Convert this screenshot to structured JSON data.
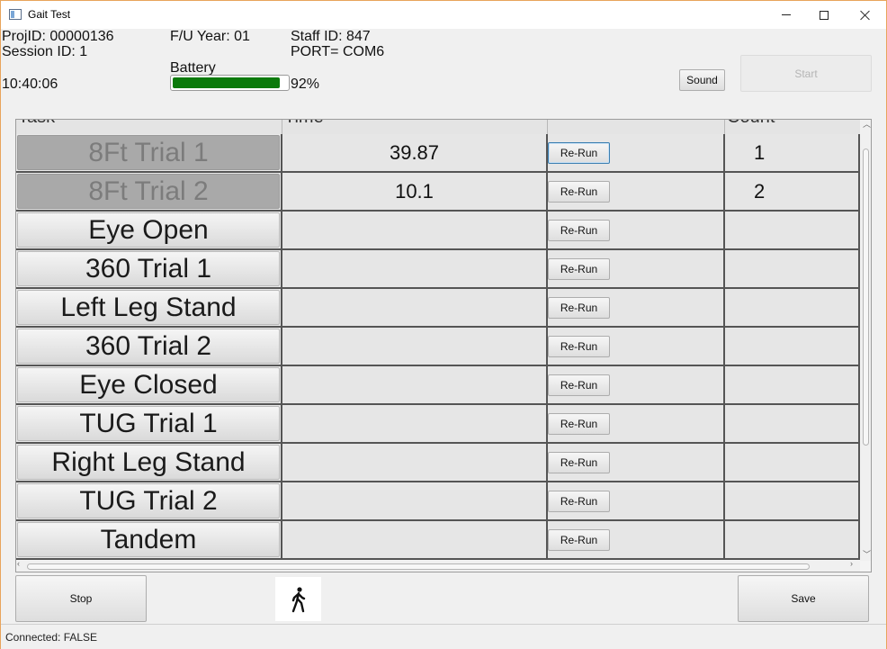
{
  "window": {
    "title": "Gait Test"
  },
  "header": {
    "proj_id": "ProjID: 00000136",
    "session_id": "Session ID: 1",
    "fu_year": "F/U Year: 01",
    "staff_id": "Staff ID: 847",
    "port": "PORT= COM6",
    "battery_label": "Battery",
    "battery_percent": 92,
    "battery_text": "92%",
    "time": "10:40:06",
    "sound_label": "Sound",
    "start_label": "Start"
  },
  "table": {
    "columns": [
      "Task",
      "Time",
      "",
      "Count"
    ],
    "rows": [
      {
        "task": "8Ft Trial 1",
        "time": "39.87",
        "rerun": "Re-Run",
        "count": "1",
        "done": true,
        "focused": true
      },
      {
        "task": "8Ft Trial 2",
        "time": "10.1",
        "rerun": "Re-Run",
        "count": "2",
        "done": true
      },
      {
        "task": "Eye Open",
        "time": "",
        "rerun": "Re-Run",
        "count": ""
      },
      {
        "task": "360 Trial 1",
        "time": "",
        "rerun": "Re-Run",
        "count": ""
      },
      {
        "task": "Left Leg Stand",
        "time": "",
        "rerun": "Re-Run",
        "count": ""
      },
      {
        "task": "360 Trial 2",
        "time": "",
        "rerun": "Re-Run",
        "count": ""
      },
      {
        "task": "Eye Closed",
        "time": "",
        "rerun": "Re-Run",
        "count": ""
      },
      {
        "task": "TUG Trial 1",
        "time": "",
        "rerun": "Re-Run",
        "count": ""
      },
      {
        "task": "Right Leg Stand",
        "time": "",
        "rerun": "Re-Run",
        "count": ""
      },
      {
        "task": "TUG Trial 2",
        "time": "",
        "rerun": "Re-Run",
        "count": ""
      },
      {
        "task": "Tandem",
        "time": "",
        "rerun": "Re-Run",
        "count": ""
      }
    ]
  },
  "footer": {
    "stop_label": "Stop",
    "save_label": "Save",
    "walk_icon": "walking-person-icon",
    "status": "Connected: FALSE"
  },
  "colors": {
    "battery_fill": "#0b7a0b",
    "window_border": "#e8a45b"
  }
}
